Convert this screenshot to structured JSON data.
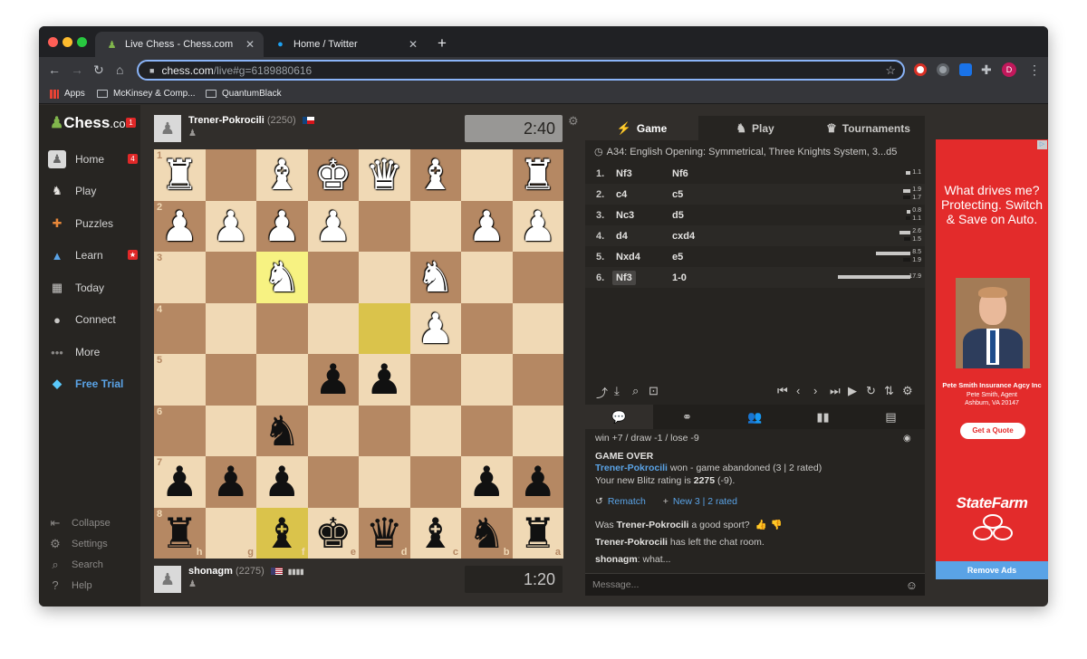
{
  "browser": {
    "tabs": [
      {
        "title": "Live Chess - Chess.com",
        "active": true
      },
      {
        "title": "Home / Twitter",
        "active": false
      }
    ],
    "url_host": "chess.com",
    "url_path": "/live#g=6189880616",
    "bookmarks": [
      "Apps",
      "McKinsey & Comp...",
      "QuantumBlack"
    ],
    "profile_initial": "D"
  },
  "sidebar": {
    "logo_main": "Chess",
    "logo_suffix": ".com",
    "logo_badge": "1",
    "items": [
      {
        "label": "Home",
        "icon": "home-icon",
        "badge": "4"
      },
      {
        "label": "Play",
        "icon": "play-icon"
      },
      {
        "label": "Puzzles",
        "icon": "puzzle-icon"
      },
      {
        "label": "Learn",
        "icon": "learn-icon",
        "badge": "★"
      },
      {
        "label": "Today",
        "icon": "today-icon"
      },
      {
        "label": "Connect",
        "icon": "connect-icon"
      },
      {
        "label": "More",
        "icon": "more-icon"
      },
      {
        "label": "Free Trial",
        "icon": "diamond-icon"
      }
    ],
    "bottom": [
      {
        "label": "Collapse",
        "icon": "collapse-icon"
      },
      {
        "label": "Settings",
        "icon": "gear-icon"
      },
      {
        "label": "Search",
        "icon": "search-icon"
      },
      {
        "label": "Help",
        "icon": "help-icon"
      }
    ]
  },
  "game": {
    "top_player": {
      "name": "Trener-Pokrocili",
      "rating": "(2250)",
      "clock": "2:40"
    },
    "bottom_player": {
      "name": "shonagm",
      "rating": "(2275)",
      "clock": "1:20"
    },
    "ranks": [
      "1",
      "2",
      "3",
      "4",
      "5",
      "6",
      "7",
      "8"
    ],
    "files": [
      "h",
      "g",
      "f",
      "e",
      "d",
      "c",
      "b",
      "a"
    ],
    "board": [
      [
        "wR",
        "",
        "wB",
        "wK",
        "wQ",
        "wB",
        "",
        "wR"
      ],
      [
        "wP",
        "wP",
        "wP",
        "wP",
        "",
        "",
        "wP",
        "wP"
      ],
      [
        "",
        "",
        "wN",
        "",
        "",
        "wN",
        "",
        ""
      ],
      [
        "",
        "",
        "",
        "",
        "",
        "wP",
        "",
        ""
      ],
      [
        "",
        "",
        "",
        "bP",
        "bP",
        "",
        "",
        ""
      ],
      [
        "",
        "",
        "bN",
        "",
        "",
        "",
        "",
        ""
      ],
      [
        "bP",
        "bP",
        "bP",
        "",
        "",
        "",
        "bP",
        "bP"
      ],
      [
        "bR",
        "",
        "bB",
        "bK",
        "bQ",
        "bB",
        "bN",
        "bR"
      ]
    ],
    "highlight_squares": [
      [
        2,
        2
      ],
      [
        3,
        4
      ],
      [
        7,
        2
      ]
    ]
  },
  "panel": {
    "tabs": [
      {
        "label": "Game",
        "icon": "lightning-icon"
      },
      {
        "label": "Play",
        "icon": "play-icon"
      },
      {
        "label": "Tournaments",
        "icon": "trophy-icon"
      }
    ],
    "opening": "A34: English Opening: Symmetrical, Three Knights System, 3...d5",
    "moves": [
      {
        "num": "1.",
        "white": "Nf3",
        "black": "Nf6",
        "t_white": "1.1",
        "t_black": ""
      },
      {
        "num": "2.",
        "white": "c4",
        "black": "c5",
        "t_white": "1.9",
        "t_black": "1.7"
      },
      {
        "num": "3.",
        "white": "Nc3",
        "black": "d5",
        "t_white": "0.8",
        "t_black": "1.1"
      },
      {
        "num": "4.",
        "white": "d4",
        "black": "cxd4",
        "t_white": "2.6",
        "t_black": "1.5"
      },
      {
        "num": "5.",
        "white": "Nxd4",
        "black": "e5",
        "t_white": "8.5",
        "t_black": "1.9"
      },
      {
        "num": "6.",
        "white": "Nf3",
        "black": "1-0",
        "t_white": "17.9",
        "t_black": ""
      }
    ],
    "chat": {
      "score": "win +7 / draw -1 / lose -9",
      "game_over": "GAME OVER",
      "winner": "Trener-Pokrocili",
      "result_text": " won - game abandoned (3 | 2 rated)",
      "rating_prefix": "Your new Blitz rating is ",
      "rating_value": "2275",
      "rating_change": " (-9).",
      "rematch": "Rematch",
      "new_game": "New 3 | 2 rated",
      "sport_q_pre": "Was ",
      "sport_q_name": "Trener-Pokrocili",
      "sport_q_post": " a good sport?",
      "left_name": "Trener-Pokrocili",
      "left_text": " has left the chat room.",
      "msg_user": "shonagm",
      "msg_text": ": what..."
    },
    "message_placeholder": "Message..."
  },
  "ad": {
    "headline": "What drives me? Protecting. Switch & Save on Auto.",
    "agency": "Pete Smith Insurance Agcy Inc",
    "agent_name": "Pete Smith, Agent",
    "agent_location": "Ashburn, VA 20147",
    "cta": "Get a Quote",
    "brand": "StateFarm",
    "remove": "Remove Ads"
  }
}
